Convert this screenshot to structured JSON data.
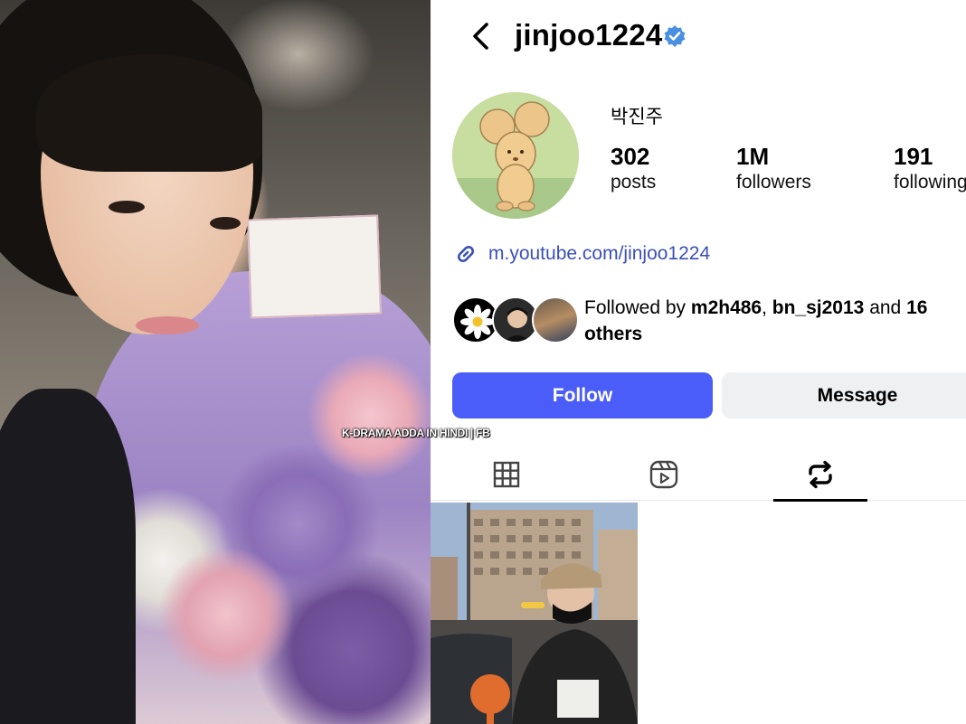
{
  "colors": {
    "accent_blue": "#4a5df9",
    "link_blue": "#3b4fb8",
    "verified_blue": "#4a90e2",
    "message_button_bg": "#eff0f2"
  },
  "photo": {
    "watermark": "K-DRAMA ADDA IN HINDI | FB"
  },
  "header": {
    "username": "jinjoo1224",
    "back_icon": "chevron-left-icon",
    "verified_icon": "verified-badge-icon"
  },
  "profile": {
    "display_name": "박진주",
    "stats": [
      {
        "value": "302",
        "label": "posts"
      },
      {
        "value": "1M",
        "label": "followers"
      },
      {
        "value": "191",
        "label": "following"
      }
    ],
    "link": {
      "icon": "link-icon",
      "text": "m.youtube.com/jinjoo1224"
    },
    "followed_by": {
      "prefix": "Followed by ",
      "user1": "m2h486",
      "separator": ", ",
      "user2": "bn_sj2013",
      "middle": " and ",
      "count": "16",
      "suffix": "others"
    }
  },
  "actions": {
    "follow_label": "Follow",
    "message_label": "Message"
  },
  "tabs": [
    {
      "name": "grid",
      "icon": "grid-icon",
      "active": false
    },
    {
      "name": "reels",
      "icon": "reels-icon",
      "active": false
    },
    {
      "name": "reposts",
      "icon": "repost-icon",
      "active": true
    },
    {
      "name": "tagged",
      "icon": "tagged-icon",
      "active": false
    }
  ]
}
